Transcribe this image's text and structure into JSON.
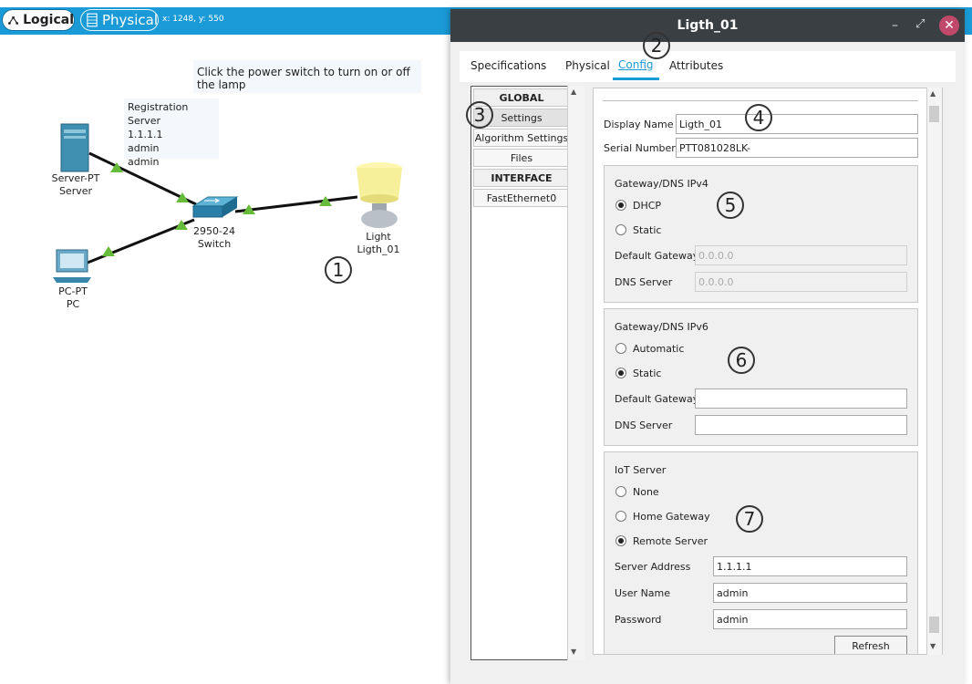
{
  "topbar": {
    "logical_label": "Logical",
    "physical_label": "Physical",
    "coords": "x: 1248, y: 550"
  },
  "workspace": {
    "notice": "Click the power switch to turn on or off the lamp",
    "note_lines": [
      "Registration Server",
      "1.1.1.1",
      "admin",
      "admin"
    ],
    "devices": {
      "server": {
        "type": "Server-PT",
        "name": "Server"
      },
      "switch": {
        "type": "2950-24",
        "name": "Switch"
      },
      "pc": {
        "type": "PC-PT",
        "name": "PC"
      },
      "light": {
        "type": "Light",
        "name": "Ligth_01"
      }
    },
    "link_color": "#66bb3a"
  },
  "callouts": [
    "1",
    "2",
    "3",
    "4",
    "5",
    "6",
    "7"
  ],
  "dialog": {
    "title": "Ligth_01",
    "tabs": [
      "Specifications",
      "Physical",
      "Config",
      "Attributes"
    ],
    "active_tab": "Config",
    "sidebar": {
      "global_header": "GLOBAL",
      "items": [
        "Settings",
        "Algorithm Settings",
        "Files"
      ],
      "interface_header": "INTERFACE",
      "interfaces": [
        "FastEthernet0"
      ]
    },
    "settings": {
      "display_name_label": "Display Name",
      "display_name": "Ligth_01",
      "serial_label": "Serial Number",
      "serial": "PTT081028LK-",
      "ipv4": {
        "title": "Gateway/DNS IPv4",
        "dhcp": "DHCP",
        "static": "Static",
        "selected": "DHCP",
        "gateway_label": "Default Gateway",
        "gateway": "0.0.0.0",
        "dns_label": "DNS Server",
        "dns": "0.0.0.0"
      },
      "ipv6": {
        "title": "Gateway/DNS IPv6",
        "automatic": "Automatic",
        "static": "Static",
        "selected": "Static",
        "gateway_label": "Default Gateway",
        "gateway": "",
        "dns_label": "DNS Server",
        "dns": ""
      },
      "iot": {
        "title": "IoT Server",
        "none": "None",
        "home_gateway": "Home Gateway",
        "remote_server": "Remote Server",
        "selected": "Remote Server",
        "address_label": "Server Address",
        "address": "1.1.1.1",
        "user_label": "User Name",
        "user": "admin",
        "password_label": "Password",
        "password": "admin",
        "refresh": "Refresh"
      }
    }
  },
  "colors": {
    "topbar": "#1a9ad6",
    "dialog_title_bg": "#3a3f44",
    "close_button": "#c0486a",
    "tab_underline": "#1a9ad6"
  }
}
